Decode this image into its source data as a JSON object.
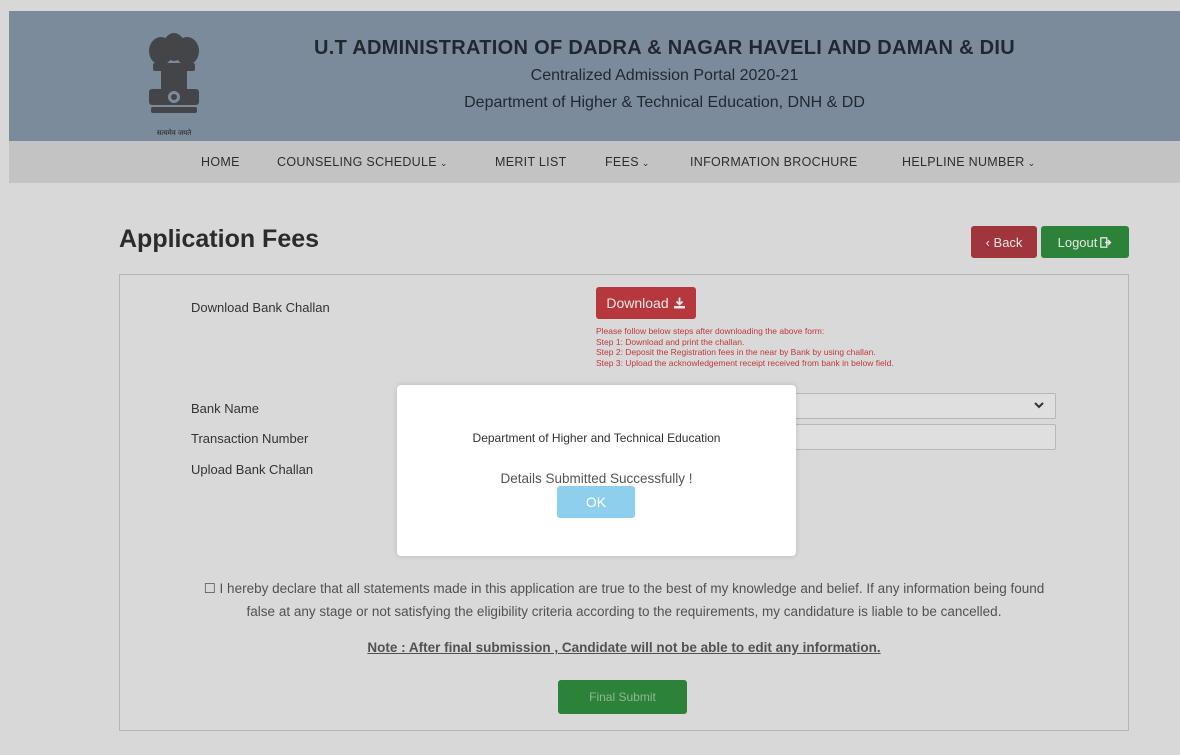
{
  "header": {
    "title": "U.T ADMINISTRATION OF DADRA & NAGAR HAVELI AND DAMAN & DIU",
    "subtitle": "Centralized Admission Portal 2020-21",
    "department": "Department of Higher & Technical Education, DNH & DD",
    "emblem_caption": "सत्यमेव जयते"
  },
  "nav": {
    "items": [
      {
        "label": "HOME",
        "dropdown": false
      },
      {
        "label": "COUNSELING SCHEDULE",
        "dropdown": true
      },
      {
        "label": "MERIT LIST",
        "dropdown": false
      },
      {
        "label": "FEES",
        "dropdown": true
      },
      {
        "label": "INFORMATION BROCHURE",
        "dropdown": false
      },
      {
        "label": "HELPLINE NUMBER",
        "dropdown": true
      }
    ],
    "caret": "⌄"
  },
  "page": {
    "title": "Application Fees",
    "back_label": "‹ Back",
    "logout_label": "Logout"
  },
  "form": {
    "download_challan_label": "Download Bank Challan",
    "download_label": "Download",
    "steps": [
      "Please follow below steps after downloading the above form:",
      "Step 1: Download and print the challan.",
      "Step 2: Deposit the Registration fees in the near by Bank by using challan.",
      "Step 3: Upload the acknowledgement receipt received from bank in below field."
    ],
    "bank_name_label": "Bank Name",
    "bank_name_value": "",
    "transaction_number_label": "Transaction Number",
    "transaction_number_value": "",
    "upload_challan_label": "Upload Bank Challan",
    "declaration_line1": "☐ I hereby declare that all statements made in this application are true to the best of my knowledge and belief. If any information being found",
    "declaration_line2": "false at any stage or not satisfying the eligibility criteria according to the requirements, my candidature is liable to be cancelled.",
    "note": "Note : After final submission , Candidate will not be able to edit any information.",
    "final_submit_label": "Final Submit"
  },
  "modal": {
    "title": "Department of Higher and Technical Education",
    "message": "Details Submitted Successfully !",
    "ok_label": "OK"
  },
  "colors": {
    "header_bg": "#8597a9",
    "nav_bg": "#d7d7d7",
    "danger": "#c8383e",
    "success": "#2b8c3a",
    "ok_button": "#8ecfee"
  }
}
